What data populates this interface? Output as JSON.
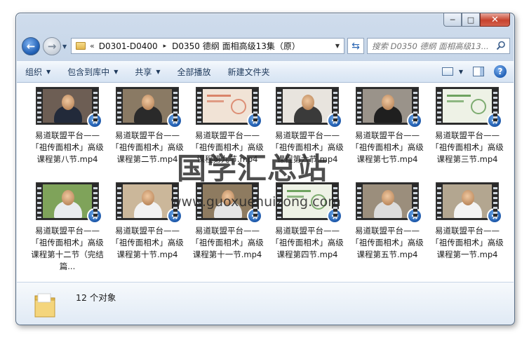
{
  "window": {
    "caption": {
      "minimize": "─",
      "maximize": "□",
      "close": "✕"
    }
  },
  "nav": {
    "back_icon": "arrow-left-icon",
    "forward_icon": "arrow-right-icon",
    "address": {
      "chevron": "«",
      "segments": [
        "D0301-D0400",
        "D0350 德纲 面相高级13集（原）"
      ],
      "separator": "▸"
    },
    "search": {
      "placeholder": "搜索 D0350 德纲 面相高级13..."
    }
  },
  "toolbar": {
    "items": [
      {
        "label": "组织",
        "dropdown": true
      },
      {
        "label": "包含到库中",
        "dropdown": true
      },
      {
        "label": "共享",
        "dropdown": true
      },
      {
        "label": "全部播放",
        "dropdown": false
      },
      {
        "label": "新建文件夹",
        "dropdown": false
      }
    ],
    "help": "?"
  },
  "files": [
    {
      "name": "易道联盟平台——「祖传面相术」高级课程第八节.mp4",
      "thumb": {
        "bg": "#6d5e54",
        "skin": true,
        "shirt": "#222a3a"
      }
    },
    {
      "name": "易道联盟平台——「祖传面相术」高级课程第二节.mp4",
      "thumb": {
        "bg": "#8a7a64",
        "skin": true,
        "shirt": "#2a2a2a"
      }
    },
    {
      "name": "易道联盟平台——「祖传面相术」高级课程第九节.mp4",
      "thumb": {
        "bg": "#f1e3d6",
        "skin": false,
        "shirt": "#d46b4d"
      }
    },
    {
      "name": "易道联盟平台——「祖传面相术」高级课程第六节.mp4",
      "thumb": {
        "bg": "#e8e4de",
        "skin": true,
        "shirt": "#3a3a3a"
      }
    },
    {
      "name": "易道联盟平台——「祖传面相术」高级课程第七节.mp4",
      "thumb": {
        "bg": "#9a938a",
        "skin": true,
        "shirt": "#1f1f1f"
      }
    },
    {
      "name": "易道联盟平台——「祖传面相术」高级课程第三节.mp4",
      "thumb": {
        "bg": "#eef2e6",
        "skin": false,
        "shirt": "#4f8f3f"
      }
    },
    {
      "name": "易道联盟平台——「祖传面相术」高级课程第十二节（完结篇...",
      "thumb": {
        "bg": "#7fa35a",
        "skin": true,
        "shirt": "#e9ecef"
      }
    },
    {
      "name": "易道联盟平台——「祖传面相术」高级课程第十节.mp4",
      "thumb": {
        "bg": "#cbb79a",
        "skin": true,
        "shirt": "#f2f2f2"
      }
    },
    {
      "name": "易道联盟平台——「祖传面相术」高级课程第十一节.mp4",
      "thumb": {
        "bg": "#8e7b60",
        "skin": true,
        "shirt": "#e5e5e5"
      }
    },
    {
      "name": "易道联盟平台——「祖传面相术」高级课程第四节.mp4",
      "thumb": {
        "bg": "#eef2e6",
        "skin": false,
        "shirt": "#4f8f3f"
      }
    },
    {
      "name": "易道联盟平台——「祖传面相术」高级课程第五节.mp4",
      "thumb": {
        "bg": "#9b8e7c",
        "skin": true,
        "shirt": "#dcdcdc"
      }
    },
    {
      "name": "易道联盟平台——「祖传面相术」高级课程第一节.mp4",
      "thumb": {
        "bg": "#b3a690",
        "skin": true,
        "shirt": "#f4f4f4"
      }
    }
  ],
  "watermark": {
    "title": "国学汇总站",
    "url": "www.guoxuehuizong.com"
  },
  "details": {
    "count_text": "12 个对象"
  },
  "colors": {
    "accent": "#2261b6",
    "toolbar_text": "#1e395b",
    "selection": "#cce8ff"
  }
}
